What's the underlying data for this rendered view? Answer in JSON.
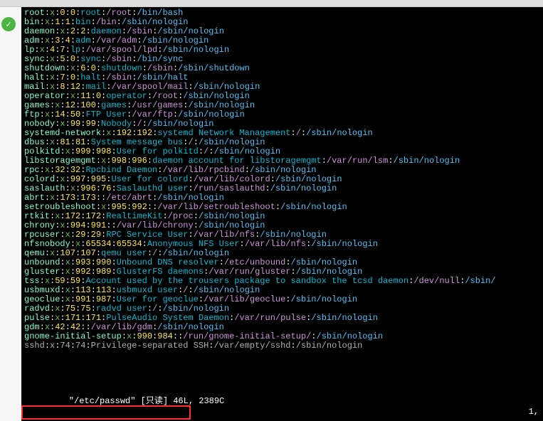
{
  "icon": {
    "check": "✓"
  },
  "ent": [
    {
      "name": "root",
      "x": "x",
      "uid": "0",
      "gid": "0",
      "desc": "root",
      "home": "/root",
      "shell": "/bin/bash"
    },
    {
      "name": "bin",
      "x": "x",
      "uid": "1",
      "gid": "1",
      "desc": "bin",
      "home": "/bin",
      "shell": "/sbin/nologin"
    },
    {
      "name": "daemon",
      "x": "x",
      "uid": "2",
      "gid": "2",
      "desc": "daemon",
      "home": "/sbin",
      "shell": "/sbin/nologin"
    },
    {
      "name": "adm",
      "x": "x",
      "uid": "3",
      "gid": "4",
      "desc": "adm",
      "home": "/var/adm",
      "shell": "/sbin/nologin"
    },
    {
      "name": "lp",
      "x": "x",
      "uid": "4",
      "gid": "7",
      "desc": "lp",
      "home": "/var/spool/lpd",
      "shell": "/sbin/nologin"
    },
    {
      "name": "sync",
      "x": "x",
      "uid": "5",
      "gid": "0",
      "desc": "sync",
      "home": "/sbin",
      "shell": "/bin/sync"
    },
    {
      "name": "shutdown",
      "x": "x",
      "uid": "6",
      "gid": "0",
      "desc": "shutdown",
      "home": "/sbin",
      "shell": "/sbin/shutdown"
    },
    {
      "name": "halt",
      "x": "x",
      "uid": "7",
      "gid": "0",
      "desc": "halt",
      "home": "/sbin",
      "shell": "/sbin/halt"
    },
    {
      "name": "mail",
      "x": "x",
      "uid": "8",
      "gid": "12",
      "desc": "mail",
      "home": "/var/spool/mail",
      "shell": "/sbin/nologin"
    },
    {
      "name": "operator",
      "x": "x",
      "uid": "11",
      "gid": "0",
      "desc": "operator",
      "home": "/root",
      "shell": "/sbin/nologin"
    },
    {
      "name": "games",
      "x": "x",
      "uid": "12",
      "gid": "100",
      "desc": "games",
      "home": "/usr/games",
      "shell": "/sbin/nologin"
    },
    {
      "name": "ftp",
      "x": "x",
      "uid": "14",
      "gid": "50",
      "desc": "FTP User",
      "home": "/var/ftp",
      "shell": "/sbin/nologin"
    },
    {
      "name": "nobody",
      "x": "x",
      "uid": "99",
      "gid": "99",
      "desc": "Nobody",
      "home": "/",
      "shell": "/sbin/nologin"
    },
    {
      "name": "systemd-network",
      "x": "x",
      "uid": "192",
      "gid": "192",
      "desc": "systemd Network Management",
      "home": "/",
      "shell": "/sbin/nologin"
    },
    {
      "name": "dbus",
      "x": "x",
      "uid": "81",
      "gid": "81",
      "desc": "System message bus",
      "home": "/",
      "shell": "/sbin/nologin"
    },
    {
      "name": "polkitd",
      "x": "x",
      "uid": "999",
      "gid": "998",
      "desc": "User for polkitd",
      "home": "/",
      "shell": "/sbin/nologin"
    },
    {
      "name": "libstoragemgmt",
      "x": "x",
      "uid": "998",
      "gid": "996",
      "desc": "daemon account for libstoragemgmt",
      "home": "/var/run/lsm",
      "shell": "/sbin/nologin"
    },
    {
      "name": "rpc",
      "x": "x",
      "uid": "32",
      "gid": "32",
      "desc": "Rpcbind Daemon",
      "home": "/var/lib/rpcbind",
      "shell": "/sbin/nologin"
    },
    {
      "name": "colord",
      "x": "x",
      "uid": "997",
      "gid": "995",
      "desc": "User for colord",
      "home": "/var/lib/colord",
      "shell": "/sbin/nologin"
    },
    {
      "name": "saslauth",
      "x": "x",
      "uid": "996",
      "gid": "76",
      "desc": "Saslauthd user",
      "home": "/run/saslauthd",
      "shell": "/sbin/nologin"
    },
    {
      "name": "abrt",
      "x": "x",
      "uid": "173",
      "gid": "173",
      "desc": "",
      "home": "/etc/abrt",
      "shell": "/sbin/nologin"
    },
    {
      "name": "setroubleshoot",
      "x": "x",
      "uid": "995",
      "gid": "992",
      "desc": "",
      "home": "/var/lib/setroubleshoot",
      "shell": "/sbin/nologin"
    },
    {
      "name": "rtkit",
      "x": "x",
      "uid": "172",
      "gid": "172",
      "desc": "RealtimeKit",
      "home": "/proc",
      "shell": "/sbin/nologin"
    },
    {
      "name": "chrony",
      "x": "x",
      "uid": "994",
      "gid": "991",
      "desc": "",
      "home": "/var/lib/chrony",
      "shell": "/sbin/nologin"
    },
    {
      "name": "rpcuser",
      "x": "x",
      "uid": "29",
      "gid": "29",
      "desc": "RPC Service User",
      "home": "/var/lib/nfs",
      "shell": "/sbin/nologin"
    },
    {
      "name": "nfsnobody",
      "x": "x",
      "uid": "65534",
      "gid": "65534",
      "desc": "Anonymous NFS User",
      "home": "/var/lib/nfs",
      "shell": "/sbin/nologin"
    },
    {
      "name": "qemu",
      "x": "x",
      "uid": "107",
      "gid": "107",
      "desc": "qemu user",
      "home": "/",
      "shell": "/sbin/nologin"
    },
    {
      "name": "unbound",
      "x": "x",
      "uid": "993",
      "gid": "990",
      "desc": "Unbound DNS resolver",
      "home": "/etc/unbound",
      "shell": "/sbin/nologin"
    },
    {
      "name": "gluster",
      "x": "x",
      "uid": "992",
      "gid": "989",
      "desc": "GlusterFS daemons",
      "home": "/var/run/gluster",
      "shell": "/sbin/nologin"
    },
    {
      "name": "tss",
      "x": "x",
      "uid": "59",
      "gid": "59",
      "desc": "Account used by the trousers package to sandbox the tcsd daemon",
      "home": "/dev/null",
      "shell": "/sbin/"
    },
    {
      "name": "usbmuxd",
      "x": "x",
      "uid": "113",
      "gid": "113",
      "desc": "usbmuxd user",
      "home": "/",
      "shell": "/sbin/nologin"
    },
    {
      "name": "geoclue",
      "x": "x",
      "uid": "991",
      "gid": "987",
      "desc": "User for geoclue",
      "home": "/var/lib/geoclue",
      "shell": "/sbin/nologin"
    },
    {
      "name": "radvd",
      "x": "x",
      "uid": "75",
      "gid": "75",
      "desc": "radvd user",
      "home": "/",
      "shell": "/sbin/nologin"
    },
    {
      "name": "pulse",
      "x": "x",
      "uid": "171",
      "gid": "171",
      "desc": "PulseAudio System Daemon",
      "home": "/var/run/pulse",
      "shell": "/sbin/nologin"
    },
    {
      "name": "gdm",
      "x": "x",
      "uid": "42",
      "gid": "42",
      "desc": "",
      "home": "/var/lib/gdm",
      "shell": "/sbin/nologin"
    },
    {
      "name": "gnome-initial-setup",
      "x": "x",
      "uid": "990",
      "gid": "984",
      "desc": "",
      "home": "/run/gnome-initial-setup/",
      "shell": "/sbin/nologin"
    },
    {
      "name": "sshd",
      "x": "x",
      "uid": "74",
      "gid": "74",
      "desc": "Privilege-separated SSH",
      "home": "/var/empty/sshd",
      "shell": "/sbin/nologin",
      "dim": true
    }
  ],
  "status": {
    "left": "\"/etc/passwd\" [只读] 46L, 2389C",
    "right": "1,"
  },
  "colon": ":"
}
